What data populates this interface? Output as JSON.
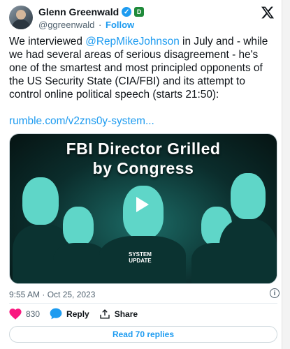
{
  "author": {
    "name": "Glenn Greenwald",
    "handle": "@ggreenwald",
    "follow_label": "Follow",
    "affiliate_badge": "D"
  },
  "tweet": {
    "text_before_mention": "We interviewed ",
    "mention": "@RepMikeJohnson",
    "text_after_mention": " in July and - while we had several areas of serious disagreement - he's one of the smartest and most principled opponents of the US Security State (CIA/FBI) and its attempt to control online political speech (starts 21:50):",
    "link": "rumble.com/v2zns0y-system..."
  },
  "media": {
    "title_line1": "FBI Director Grilled",
    "title_line2": "by Congress",
    "badge_line1": "SYSTEM",
    "badge_line2": "UPDATE"
  },
  "meta": {
    "timestamp": "9:55 AM · Oct 25, 2023"
  },
  "actions": {
    "like_count": "830",
    "reply_label": "Reply",
    "share_label": "Share",
    "read_replies_label": "Read 70 replies"
  },
  "colors": {
    "accent": "#1d9bf0",
    "like": "#f91880",
    "text": "#0f1419",
    "muted": "#536471"
  }
}
